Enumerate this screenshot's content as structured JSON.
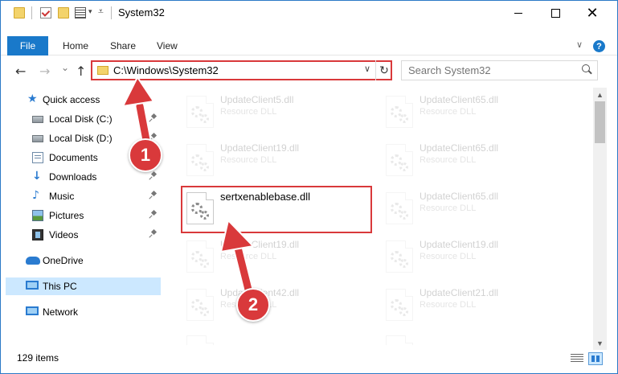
{
  "titlebar": {
    "title": "System32",
    "minimize_label": "",
    "maximize_label": "",
    "close_glyph": "✕"
  },
  "ribbon": {
    "file_tab": "File",
    "tabs": [
      "Home",
      "Share",
      "View"
    ],
    "collapse_glyph": "∨",
    "help_glyph": "?"
  },
  "nav": {
    "back_glyph": "←",
    "forward_glyph": "→",
    "recent_glyph": "⌄",
    "up_glyph": "↑",
    "address": "C:\\Windows\\System32",
    "address_dropdown_glyph": "∨",
    "refresh_glyph": "↻",
    "search_placeholder": "Search System32"
  },
  "sidebar": {
    "items": [
      {
        "label": "Quick access",
        "icon": "star-icon"
      },
      {
        "label": "Local Disk (C:)",
        "icon": "disk-icon",
        "pinned": true
      },
      {
        "label": "Local Disk (D:)",
        "icon": "disk-icon",
        "pinned": true
      },
      {
        "label": "Documents",
        "icon": "documents-icon",
        "pinned": true
      },
      {
        "label": "Downloads",
        "icon": "download-icon",
        "pinned": true
      },
      {
        "label": "Music",
        "icon": "music-icon",
        "pinned": true
      },
      {
        "label": "Pictures",
        "icon": "pictures-icon",
        "pinned": true
      },
      {
        "label": "Videos",
        "icon": "videos-icon",
        "pinned": true
      },
      {
        "label": "OneDrive",
        "icon": "cloud-icon"
      },
      {
        "label": "This PC",
        "icon": "computer-icon",
        "selected": true
      },
      {
        "label": "Network",
        "icon": "network-icon"
      }
    ]
  },
  "files": {
    "left_column": [
      {
        "name": "UpdateClient5.dll",
        "type": "Resource DLL",
        "faded": true
      },
      {
        "name": "UpdateClient19.dll",
        "type": "Resource DLL",
        "faded": true
      },
      {
        "name": "sertxenablebase.dll",
        "type": "",
        "faded": false,
        "highlighted": true
      },
      {
        "name": "UpdateClient19.dll",
        "type": "Resource DLL",
        "faded": true
      },
      {
        "name": "UpdateClient42.dll",
        "type": "Resource DLL",
        "faded": true
      },
      {
        "name": "",
        "type": "",
        "faded": true
      }
    ],
    "right_column": [
      {
        "name": "UpdateClient65.dll",
        "type": "Resource DLL",
        "faded": true
      },
      {
        "name": "UpdateClient65.dll",
        "type": "Resource DLL",
        "faded": true
      },
      {
        "name": "UpdateClient65.dll",
        "type": "Resource DLL",
        "faded": true
      },
      {
        "name": "UpdateClient19.dll",
        "type": "Resource DLL",
        "faded": true
      },
      {
        "name": "UpdateClient21.dll",
        "type": "Resource DLL",
        "faded": true
      },
      {
        "name": "",
        "type": "",
        "faded": true
      }
    ]
  },
  "scrollbar": {
    "up_glyph": "▲",
    "down_glyph": "▼"
  },
  "statusbar": {
    "item_count": "129 items"
  },
  "annotations": {
    "step1": "1",
    "step2": "2",
    "accent_color": "#d9393b"
  }
}
